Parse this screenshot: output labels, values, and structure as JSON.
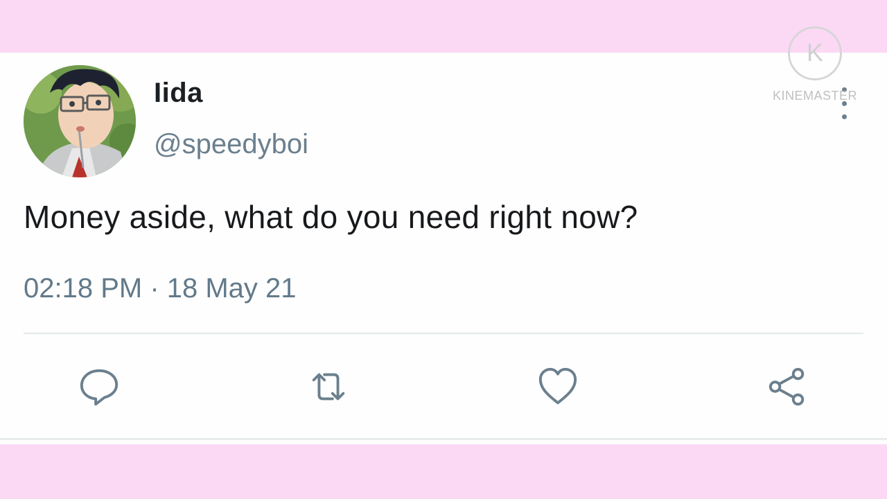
{
  "tweet": {
    "display_name": "Iida",
    "handle": "@speedyboi",
    "text": "Money aside, what do you need right now?",
    "timestamp": "02:18 PM · 18 May 21"
  },
  "actions": [
    {
      "name": "reply",
      "icon": "speech-bubble-icon"
    },
    {
      "name": "retweet",
      "icon": "retweet-icon"
    },
    {
      "name": "like",
      "icon": "heart-icon"
    },
    {
      "name": "share",
      "icon": "share-icon"
    }
  ],
  "watermark": {
    "text": "KINEMASTER",
    "logo_letter": "K"
  },
  "colors": {
    "frame_pink": "#fbd9f5",
    "card": "#fdfefd",
    "secondary_text": "#62798a",
    "primary_text": "#17191c"
  }
}
